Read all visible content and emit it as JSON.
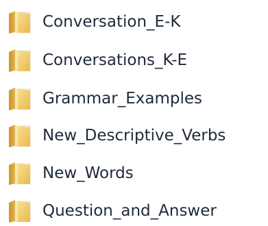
{
  "folders": [
    {
      "name": "Conversation_E-K",
      "icon": "folder-icon"
    },
    {
      "name": "Conversations_K-E",
      "icon": "folder-icon"
    },
    {
      "name": "Grammar_Examples",
      "icon": "folder-icon"
    },
    {
      "name": "New_Descriptive_Verbs",
      "icon": "folder-icon"
    },
    {
      "name": "New_Words",
      "icon": "folder-icon"
    },
    {
      "name": "Question_and_Answer",
      "icon": "folder-icon"
    }
  ],
  "colors": {
    "folder_back": "#d9a93a",
    "folder_front": "#f3cf6a",
    "folder_highlight": "#fbe6a6",
    "folder_paper": "#f7f3e6",
    "text": "#1e2a3a"
  }
}
